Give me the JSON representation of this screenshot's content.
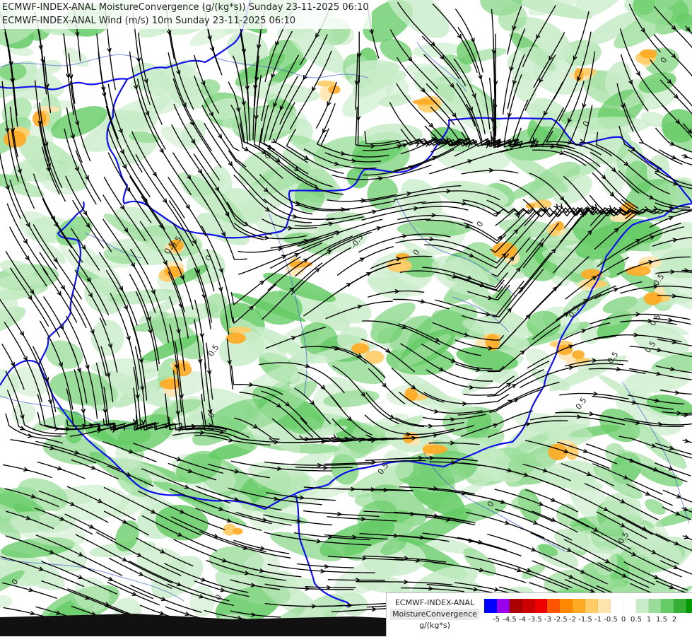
{
  "titles": {
    "line1": "ECMWF-INDEX-ANAL MoistureConvergence (g/(kg*s)) Sunday 23-11-2025 06:10",
    "line2": "ECMWF-INDEX-ANAL Wind (m/s) 10m Sunday 23-11-2025 06:10"
  },
  "legend": {
    "product": "ECMWF-INDEX-ANAL",
    "parameter": "MoistureConvergence",
    "unit": "g/(kg*s)",
    "colors": [
      "#0000ff",
      "#9900ee",
      "#aa0000",
      "#cc0000",
      "#ee0000",
      "#ff5500",
      "#ff8800",
      "#ffaa22",
      "#ffcc66",
      "#ffe4b0",
      "#ffffff",
      "#ffffff",
      "#c8ecc8",
      "#99dd99",
      "#66cc66",
      "#33b033",
      "#009900"
    ],
    "ticks": [
      "-5",
      "-4.5",
      "-4",
      "-3.5",
      "-3",
      "-2.5",
      "-2",
      "-1.5",
      "-1",
      "-0.5",
      "0",
      "0.5",
      "1",
      "1.5",
      "2"
    ]
  },
  "map": {
    "background_color": "#ffffff",
    "convergence_colors": {
      "weak_green": "#c8ecc8",
      "green": "#99dd99",
      "strong_green": "#66cc66",
      "weak_orange": "#ffe4b0",
      "orange": "#ffcc66",
      "strong_orange": "#ffaa22"
    },
    "border_color": "#1010ee",
    "river_color": "#3355cc",
    "streamline_color": "#000000",
    "contour_labels": [
      "0",
      "0",
      "0",
      "0",
      "0",
      "0",
      "0",
      "0",
      "0",
      "0",
      "-0.5",
      "-0.5",
      "0.5",
      "0.5",
      "0.5",
      "0.5",
      "0.5",
      "0.5",
      "0.5",
      "0.5",
      "0.5",
      "0.5"
    ]
  }
}
